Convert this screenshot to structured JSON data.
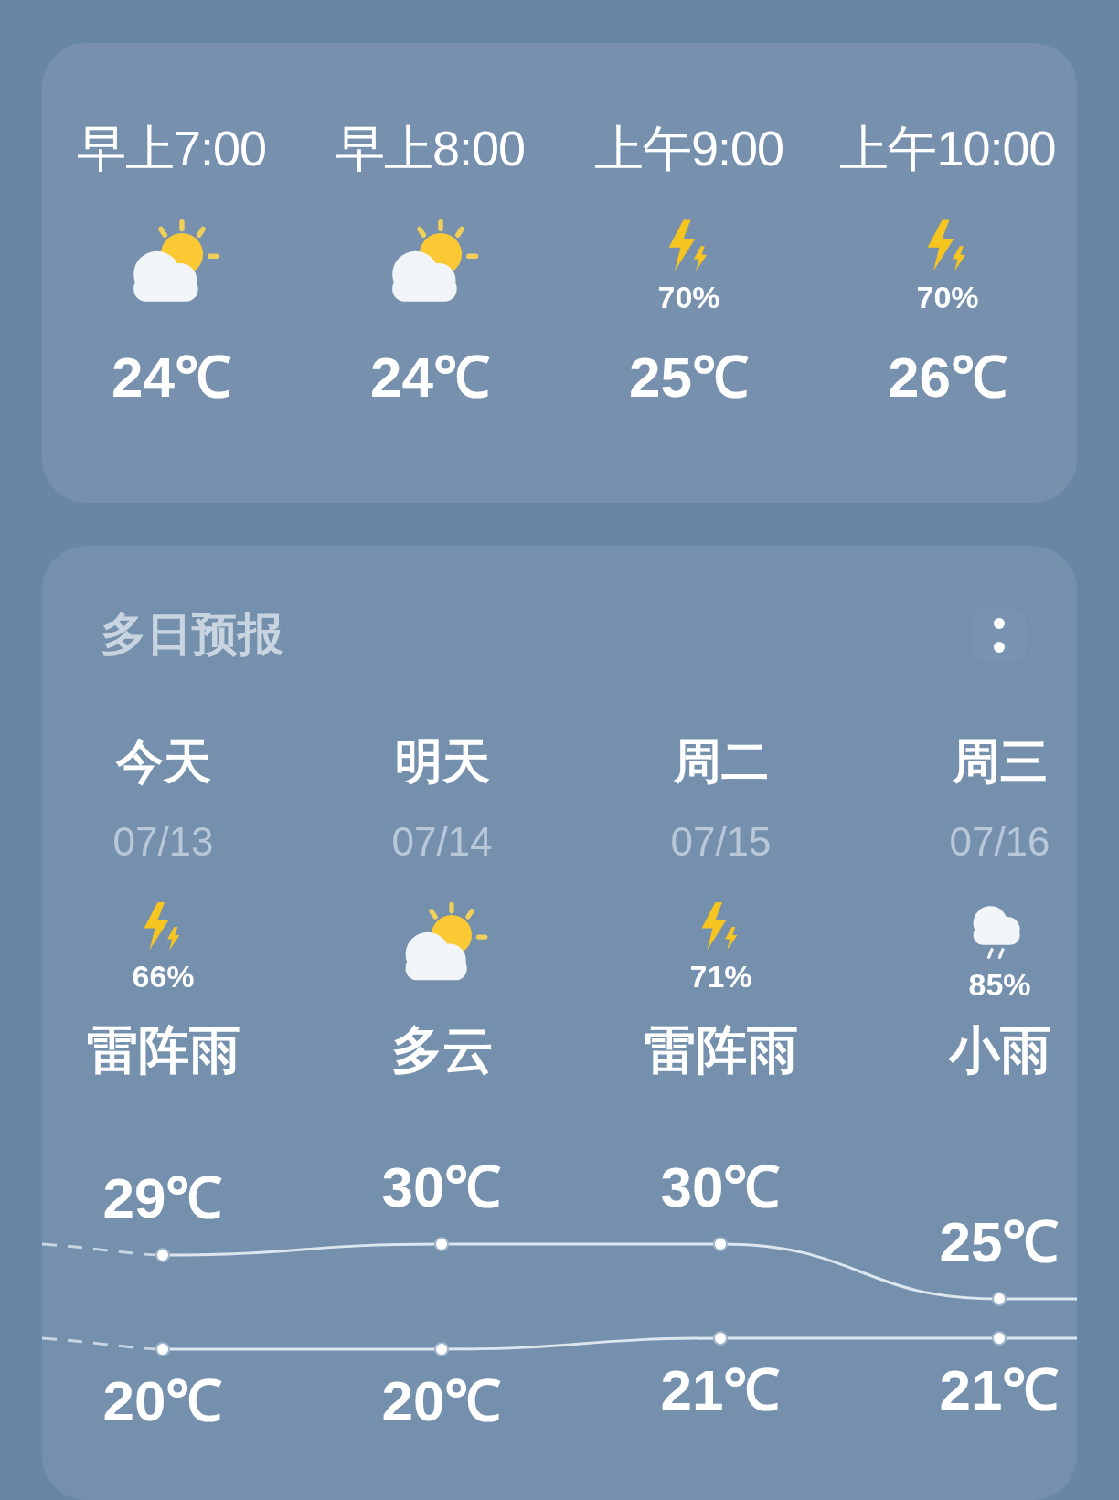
{
  "hourly": [
    {
      "time": "早上7:00",
      "kind": "partly_cloudy",
      "temp": "24℃"
    },
    {
      "time": "早上8:00",
      "kind": "partly_cloudy",
      "temp": "24℃"
    },
    {
      "time": "上午9:00",
      "kind": "thunder",
      "precip": "70%",
      "temp": "25℃"
    },
    {
      "time": "上午10:00",
      "kind": "thunder",
      "precip": "70%",
      "temp": "26℃"
    }
  ],
  "forecast": {
    "title": "多日预报",
    "days": [
      {
        "day": "今天",
        "date": "07/13",
        "kind": "thunder",
        "precip": "66%",
        "condition": "雷阵雨",
        "high": "29℃",
        "low": "20℃"
      },
      {
        "day": "明天",
        "date": "07/14",
        "kind": "partly_cloudy",
        "condition": "多云",
        "high": "30℃",
        "low": "20℃"
      },
      {
        "day": "周二",
        "date": "07/15",
        "kind": "thunder",
        "precip": "71%",
        "condition": "雷阵雨",
        "high": "30℃",
        "low": "21℃"
      },
      {
        "day": "周三",
        "date": "07/16",
        "kind": "light_rain",
        "precip": "85%",
        "condition": "小雨",
        "high": "25℃",
        "low": "21℃"
      }
    ]
  }
}
